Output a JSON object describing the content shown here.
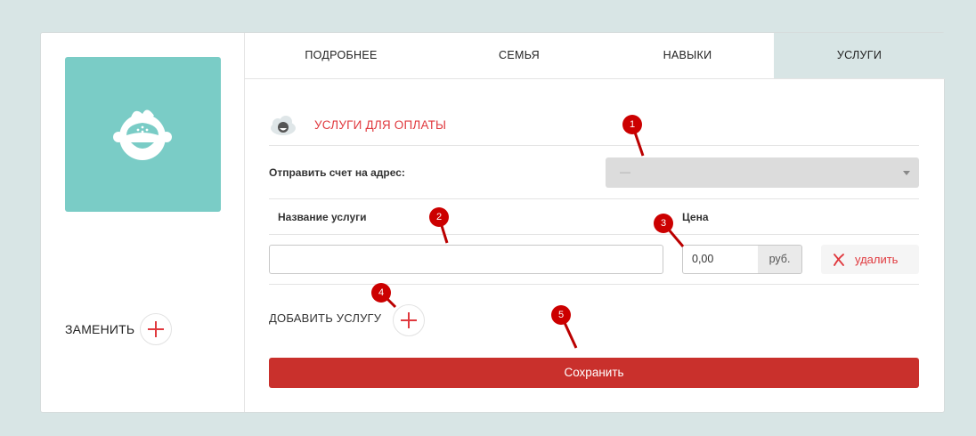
{
  "left_panel": {
    "replace_label": "ЗАМЕНИТЬ"
  },
  "tabs": [
    {
      "label": "ПОДРОБНЕЕ",
      "active": false
    },
    {
      "label": "СЕМЬЯ",
      "active": false
    },
    {
      "label": "НАВЫКИ",
      "active": false
    },
    {
      "label": "УСЛУГИ",
      "active": true
    }
  ],
  "section": {
    "title": "УСЛУГИ ДЛЯ ОПЛАТЫ"
  },
  "form": {
    "send_invoice_label": "Отправить счет на адрес:",
    "send_invoice_value": "—",
    "service_name_header": "Название услуги",
    "price_header": "Цена",
    "service_name_value": "",
    "price_value": "0,00",
    "currency": "руб.",
    "delete_label": "удалить",
    "add_service_label": "ДОБАВИТЬ УСЛУГУ",
    "save_label": "Сохранить"
  },
  "markers": [
    "1",
    "2",
    "3",
    "4",
    "5"
  ],
  "colors": {
    "accent": "#e0393e",
    "save_button": "#c9302c",
    "avatar_bg": "#7accc6",
    "page_bg": "#d8e5e5",
    "marker": "#cc0000"
  }
}
